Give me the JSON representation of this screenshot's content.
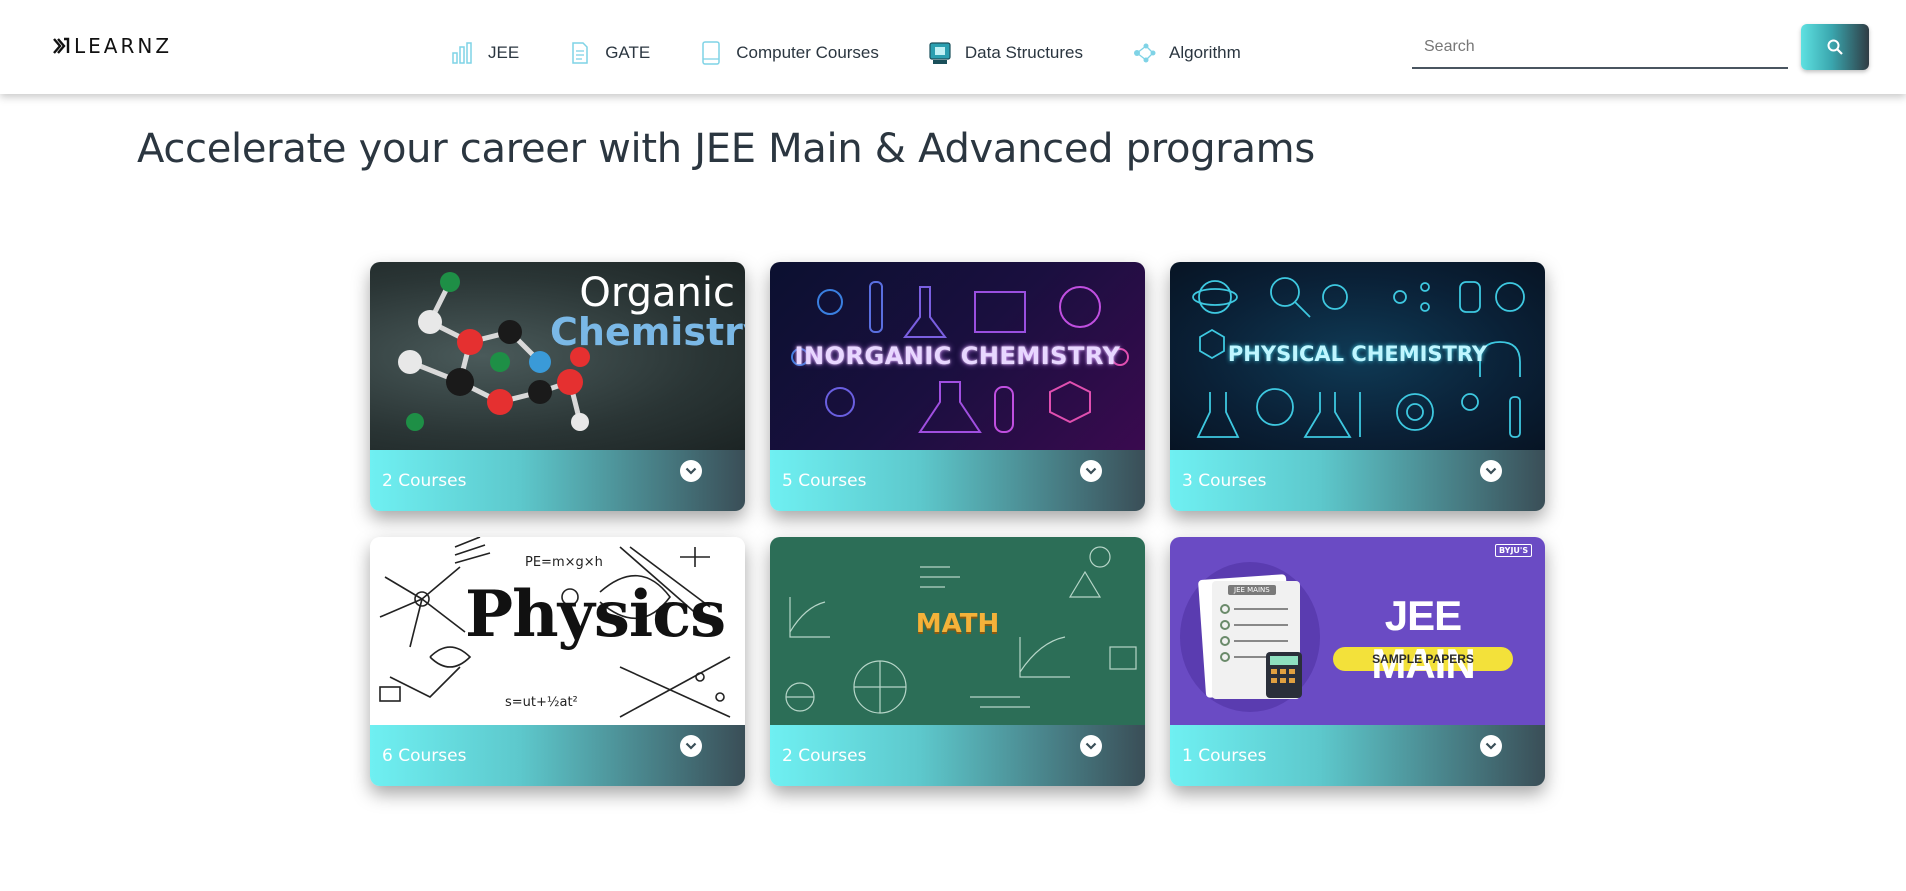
{
  "brand": {
    "name": "LEARNZ"
  },
  "nav": [
    {
      "label": "JEE",
      "icon": "bar-chart-icon"
    },
    {
      "label": "GATE",
      "icon": "document-icon"
    },
    {
      "label": "Computer Courses",
      "icon": "tablet-icon"
    },
    {
      "label": "Data Structures",
      "icon": "computer-chip-icon"
    },
    {
      "label": "Algorithm",
      "icon": "network-icon"
    }
  ],
  "search": {
    "placeholder": "Search",
    "value": "",
    "button_icon": "search-icon"
  },
  "headline": "Accelerate your career with JEE Main & Advanced programs",
  "cards": [
    {
      "image_title_line1": "Organic",
      "image_title_line2": "Chemistry",
      "courses": "2 Courses"
    },
    {
      "image_title": "INORGANIC CHEMISTRY",
      "courses": "5 Courses"
    },
    {
      "image_title": "PHYSICAL CHEMISTRY",
      "courses": "3 Courses"
    },
    {
      "image_title": "Physics",
      "formula_1": "PE=m×g×h",
      "formula_2": "s=ut+½at²",
      "courses": "6 Courses"
    },
    {
      "image_title": "MATH",
      "courses": "2 Courses"
    },
    {
      "image_title": "JEE MAIN",
      "image_subtitle": "SAMPLE PAPERS",
      "image_badge": "BYJU'S",
      "image_doc_label": "JEE MAINS",
      "courses": "1 Courses"
    }
  ],
  "colors": {
    "accent_gradient_start": "#6ff0f2",
    "accent_gradient_end": "#3a4e57",
    "text_dark": "#2b3640",
    "jee_purple": "#6a4bc4"
  }
}
